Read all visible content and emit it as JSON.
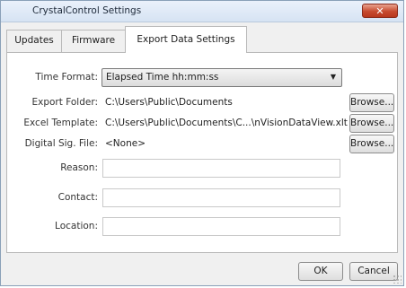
{
  "window": {
    "title": "CrystalControl Settings",
    "close_glyph": "✕"
  },
  "tabs": [
    {
      "label": "Updates",
      "active": false
    },
    {
      "label": "Firmware",
      "active": false
    },
    {
      "label": "Export Data Settings",
      "active": true
    }
  ],
  "form": {
    "time_format": {
      "label": "Time Format:",
      "value": "Elapsed Time hh:mm:ss"
    },
    "export_folder": {
      "label": "Export Folder:",
      "value": "C:\\Users\\Public\\Documents",
      "button": "Browse..."
    },
    "excel_template": {
      "label": "Excel Template:",
      "value": "C:\\Users\\Public\\Documents\\C...\\nVisionDataView.xlt",
      "button": "Browse..."
    },
    "digital_sig": {
      "label": "Digital Sig. File:",
      "value": "<None>",
      "button": "Browse..."
    },
    "reason": {
      "label": "Reason:",
      "value": ""
    },
    "contact": {
      "label": "Contact:",
      "value": ""
    },
    "location": {
      "label": "Location:",
      "value": ""
    }
  },
  "footer": {
    "ok_label": "OK",
    "cancel_label": "Cancel"
  }
}
